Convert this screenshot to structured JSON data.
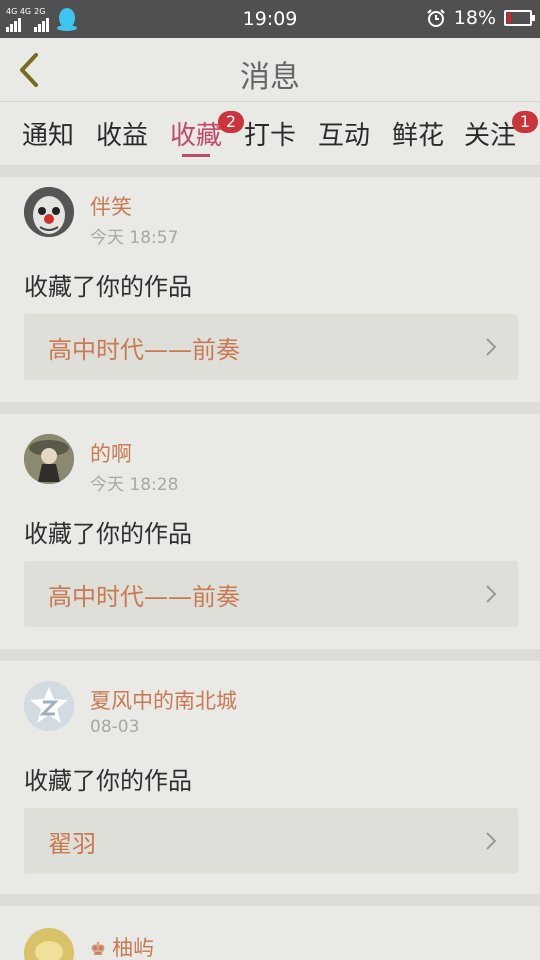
{
  "status_bar": {
    "network_top": "4G 4G",
    "network_top2": "2G",
    "time": "19:09",
    "battery_pct": "18%",
    "battery_level": 0.18,
    "battery_color": "#e02020"
  },
  "header": {
    "title": "消息"
  },
  "tabs": [
    {
      "label": "通知",
      "badge": ""
    },
    {
      "label": "收益",
      "badge": ""
    },
    {
      "label": "收藏",
      "badge": "2",
      "active": true
    },
    {
      "label": "打卡",
      "badge": ""
    },
    {
      "label": "互动",
      "badge": ""
    },
    {
      "label": "鲜花",
      "badge": ""
    },
    {
      "label": "关注",
      "badge": "1"
    }
  ],
  "messages": [
    {
      "user": "伴笑",
      "time": "今天 18:57",
      "action": "收藏了你的作品",
      "work": "高中时代——前奏",
      "avatar": "clown-avatar"
    },
    {
      "user": "的啊",
      "time": "今天 18:28",
      "action": "收藏了你的作品",
      "work": "高中时代——前奏",
      "avatar": "girl-avatar"
    },
    {
      "user": "夏风中的南北城",
      "time": "08-03",
      "action": "收藏了你的作品",
      "work": "翟羽",
      "avatar": "default-avatar"
    },
    {
      "user": "柚屿",
      "time": "",
      "action": "",
      "work": "",
      "avatar": "yellow-avatar",
      "crown": "♚"
    }
  ],
  "colors": {
    "accent": "#c04a6a",
    "username": "#c97a52",
    "badge": "#c9353b",
    "background": "#e9e9e6"
  }
}
